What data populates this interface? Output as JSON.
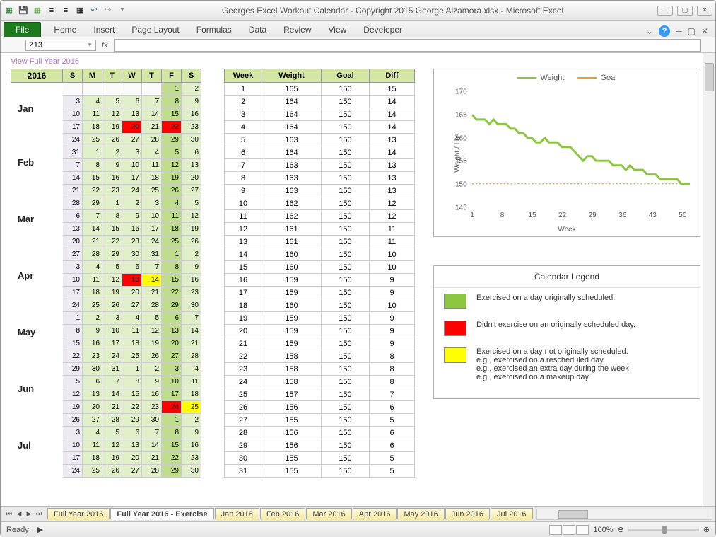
{
  "title": "Georges Excel Workout Calendar - Copyright 2015 George Alzamora.xlsx  -  Microsoft Excel",
  "ribbon": {
    "file": "File",
    "tabs": [
      "Home",
      "Insert",
      "Page Layout",
      "Formulas",
      "Data",
      "Review",
      "View",
      "Developer"
    ]
  },
  "namebox": "Z13",
  "fx": "fx",
  "link": "View Full Year 2016",
  "year": "2016",
  "day_heads": [
    "S",
    "M",
    "T",
    "W",
    "T",
    "F",
    "S"
  ],
  "months": [
    "Jan",
    "Feb",
    "Mar",
    "Apr",
    "May",
    "Jun",
    "Jul"
  ],
  "calendar_rows": [
    [
      [
        "",
        "b"
      ],
      [
        "",
        "b"
      ],
      [
        "",
        "b"
      ],
      [
        "",
        "b"
      ],
      [
        "",
        "b"
      ],
      [
        "1",
        "green"
      ],
      [
        "2",
        "lgreen"
      ]
    ],
    [
      [
        "3",
        "pale"
      ],
      [
        "4",
        "lgreen"
      ],
      [
        "5",
        "lgreen"
      ],
      [
        "6",
        "lgreen"
      ],
      [
        "7",
        "lgreen"
      ],
      [
        "8",
        "green"
      ],
      [
        "9",
        "lgreen"
      ]
    ],
    [
      [
        "10",
        "pale"
      ],
      [
        "11",
        "lgreen"
      ],
      [
        "12",
        "lgreen"
      ],
      [
        "13",
        "lgreen"
      ],
      [
        "14",
        "lgreen"
      ],
      [
        "15",
        "green"
      ],
      [
        "16",
        "lgreen"
      ]
    ],
    [
      [
        "17",
        "pale"
      ],
      [
        "18",
        "lgreen"
      ],
      [
        "19",
        "lgreen"
      ],
      [
        "20",
        "red"
      ],
      [
        "21",
        "lgreen"
      ],
      [
        "22",
        "red"
      ],
      [
        "23",
        "lgreen"
      ]
    ],
    [
      [
        "24",
        "pale"
      ],
      [
        "25",
        "lgreen"
      ],
      [
        "26",
        "lgreen"
      ],
      [
        "27",
        "lgreen"
      ],
      [
        "28",
        "lgreen"
      ],
      [
        "29",
        "green"
      ],
      [
        "30",
        "lgreen"
      ]
    ],
    [
      [
        "31",
        "pale"
      ],
      [
        "1",
        "lgreen"
      ],
      [
        "2",
        "lgreen"
      ],
      [
        "3",
        "lgreen"
      ],
      [
        "4",
        "lgreen"
      ],
      [
        "5",
        "green"
      ],
      [
        "6",
        "lgreen"
      ]
    ],
    [
      [
        "7",
        "pale"
      ],
      [
        "8",
        "lgreen"
      ],
      [
        "9",
        "lgreen"
      ],
      [
        "10",
        "lgreen"
      ],
      [
        "11",
        "lgreen"
      ],
      [
        "12",
        "green"
      ],
      [
        "13",
        "lgreen"
      ]
    ],
    [
      [
        "14",
        "pale"
      ],
      [
        "15",
        "lgreen"
      ],
      [
        "16",
        "lgreen"
      ],
      [
        "17",
        "lgreen"
      ],
      [
        "18",
        "lgreen"
      ],
      [
        "19",
        "green"
      ],
      [
        "20",
        "lgreen"
      ]
    ],
    [
      [
        "21",
        "pale"
      ],
      [
        "22",
        "lgreen"
      ],
      [
        "23",
        "lgreen"
      ],
      [
        "24",
        "lgreen"
      ],
      [
        "25",
        "lgreen"
      ],
      [
        "26",
        "green"
      ],
      [
        "27",
        "lgreen"
      ]
    ],
    [
      [
        "28",
        "pale"
      ],
      [
        "29",
        "lgreen"
      ],
      [
        "1",
        "lgreen"
      ],
      [
        "2",
        "lgreen"
      ],
      [
        "3",
        "lgreen"
      ],
      [
        "4",
        "green"
      ],
      [
        "5",
        "lgreen"
      ]
    ],
    [
      [
        "6",
        "pale"
      ],
      [
        "7",
        "lgreen"
      ],
      [
        "8",
        "lgreen"
      ],
      [
        "9",
        "lgreen"
      ],
      [
        "10",
        "lgreen"
      ],
      [
        "11",
        "green"
      ],
      [
        "12",
        "lgreen"
      ]
    ],
    [
      [
        "13",
        "pale"
      ],
      [
        "14",
        "lgreen"
      ],
      [
        "15",
        "lgreen"
      ],
      [
        "16",
        "lgreen"
      ],
      [
        "17",
        "lgreen"
      ],
      [
        "18",
        "green"
      ],
      [
        "19",
        "lgreen"
      ]
    ],
    [
      [
        "20",
        "pale"
      ],
      [
        "21",
        "lgreen"
      ],
      [
        "22",
        "lgreen"
      ],
      [
        "23",
        "lgreen"
      ],
      [
        "24",
        "lgreen"
      ],
      [
        "25",
        "green"
      ],
      [
        "26",
        "lgreen"
      ]
    ],
    [
      [
        "27",
        "pale"
      ],
      [
        "28",
        "lgreen"
      ],
      [
        "29",
        "lgreen"
      ],
      [
        "30",
        "lgreen"
      ],
      [
        "31",
        "lgreen"
      ],
      [
        "1",
        "green"
      ],
      [
        "2",
        "lgreen"
      ]
    ],
    [
      [
        "3",
        "pale"
      ],
      [
        "4",
        "lgreen"
      ],
      [
        "5",
        "lgreen"
      ],
      [
        "6",
        "lgreen"
      ],
      [
        "7",
        "lgreen"
      ],
      [
        "8",
        "green"
      ],
      [
        "9",
        "lgreen"
      ]
    ],
    [
      [
        "10",
        "pale"
      ],
      [
        "11",
        "lgreen"
      ],
      [
        "12",
        "lgreen"
      ],
      [
        "13",
        "red"
      ],
      [
        "14",
        "yellow"
      ],
      [
        "15",
        "green"
      ],
      [
        "16",
        "lgreen"
      ]
    ],
    [
      [
        "17",
        "pale"
      ],
      [
        "18",
        "lgreen"
      ],
      [
        "19",
        "lgreen"
      ],
      [
        "20",
        "lgreen"
      ],
      [
        "21",
        "lgreen"
      ],
      [
        "22",
        "green"
      ],
      [
        "23",
        "lgreen"
      ]
    ],
    [
      [
        "24",
        "pale"
      ],
      [
        "25",
        "lgreen"
      ],
      [
        "26",
        "lgreen"
      ],
      [
        "27",
        "lgreen"
      ],
      [
        "28",
        "lgreen"
      ],
      [
        "29",
        "green"
      ],
      [
        "30",
        "lgreen"
      ]
    ],
    [
      [
        "1",
        "pale"
      ],
      [
        "2",
        "lgreen"
      ],
      [
        "3",
        "lgreen"
      ],
      [
        "4",
        "lgreen"
      ],
      [
        "5",
        "lgreen"
      ],
      [
        "6",
        "green"
      ],
      [
        "7",
        "lgreen"
      ]
    ],
    [
      [
        "8",
        "pale"
      ],
      [
        "9",
        "lgreen"
      ],
      [
        "10",
        "lgreen"
      ],
      [
        "11",
        "lgreen"
      ],
      [
        "12",
        "lgreen"
      ],
      [
        "13",
        "green"
      ],
      [
        "14",
        "lgreen"
      ]
    ],
    [
      [
        "15",
        "pale"
      ],
      [
        "16",
        "lgreen"
      ],
      [
        "17",
        "lgreen"
      ],
      [
        "18",
        "lgreen"
      ],
      [
        "19",
        "lgreen"
      ],
      [
        "20",
        "green"
      ],
      [
        "21",
        "lgreen"
      ]
    ],
    [
      [
        "22",
        "pale"
      ],
      [
        "23",
        "lgreen"
      ],
      [
        "24",
        "lgreen"
      ],
      [
        "25",
        "lgreen"
      ],
      [
        "26",
        "lgreen"
      ],
      [
        "27",
        "green"
      ],
      [
        "28",
        "lgreen"
      ]
    ],
    [
      [
        "29",
        "pale"
      ],
      [
        "30",
        "lgreen"
      ],
      [
        "31",
        "lgreen"
      ],
      [
        "1",
        "lgreen"
      ],
      [
        "2",
        "lgreen"
      ],
      [
        "3",
        "green"
      ],
      [
        "4",
        "lgreen"
      ]
    ],
    [
      [
        "5",
        "pale"
      ],
      [
        "6",
        "lgreen"
      ],
      [
        "7",
        "lgreen"
      ],
      [
        "8",
        "lgreen"
      ],
      [
        "9",
        "lgreen"
      ],
      [
        "10",
        "green"
      ],
      [
        "11",
        "lgreen"
      ]
    ],
    [
      [
        "12",
        "pale"
      ],
      [
        "13",
        "lgreen"
      ],
      [
        "14",
        "lgreen"
      ],
      [
        "15",
        "lgreen"
      ],
      [
        "16",
        "lgreen"
      ],
      [
        "17",
        "green"
      ],
      [
        "18",
        "lgreen"
      ]
    ],
    [
      [
        "19",
        "pale"
      ],
      [
        "20",
        "lgreen"
      ],
      [
        "21",
        "lgreen"
      ],
      [
        "22",
        "lgreen"
      ],
      [
        "23",
        "lgreen"
      ],
      [
        "24",
        "red"
      ],
      [
        "25",
        "yellow"
      ]
    ],
    [
      [
        "26",
        "pale"
      ],
      [
        "27",
        "lgreen"
      ],
      [
        "28",
        "lgreen"
      ],
      [
        "29",
        "lgreen"
      ],
      [
        "30",
        "lgreen"
      ],
      [
        "1",
        "green"
      ],
      [
        "2",
        "lgreen"
      ]
    ],
    [
      [
        "3",
        "pale"
      ],
      [
        "4",
        "lgreen"
      ],
      [
        "5",
        "lgreen"
      ],
      [
        "6",
        "lgreen"
      ],
      [
        "7",
        "lgreen"
      ],
      [
        "8",
        "green"
      ],
      [
        "9",
        "lgreen"
      ]
    ],
    [
      [
        "10",
        "pale"
      ],
      [
        "11",
        "lgreen"
      ],
      [
        "12",
        "lgreen"
      ],
      [
        "13",
        "lgreen"
      ],
      [
        "14",
        "lgreen"
      ],
      [
        "15",
        "green"
      ],
      [
        "16",
        "lgreen"
      ]
    ],
    [
      [
        "17",
        "pale"
      ],
      [
        "18",
        "lgreen"
      ],
      [
        "19",
        "lgreen"
      ],
      [
        "20",
        "lgreen"
      ],
      [
        "21",
        "lgreen"
      ],
      [
        "22",
        "green"
      ],
      [
        "23",
        "lgreen"
      ]
    ],
    [
      [
        "24",
        "pale"
      ],
      [
        "25",
        "lgreen"
      ],
      [
        "26",
        "lgreen"
      ],
      [
        "27",
        "lgreen"
      ],
      [
        "28",
        "lgreen"
      ],
      [
        "29",
        "green"
      ],
      [
        "30",
        "lgreen"
      ]
    ]
  ],
  "wk_heads": [
    "Week",
    "Weight",
    "Goal",
    "Diff"
  ],
  "wk_rows": [
    [
      1,
      165,
      150,
      15
    ],
    [
      2,
      164,
      150,
      14
    ],
    [
      3,
      164,
      150,
      14
    ],
    [
      4,
      164,
      150,
      14
    ],
    [
      5,
      163,
      150,
      13
    ],
    [
      6,
      164,
      150,
      14
    ],
    [
      7,
      163,
      150,
      13
    ],
    [
      8,
      163,
      150,
      13
    ],
    [
      9,
      163,
      150,
      13
    ],
    [
      10,
      162,
      150,
      12
    ],
    [
      11,
      162,
      150,
      12
    ],
    [
      12,
      161,
      150,
      11
    ],
    [
      13,
      161,
      150,
      11
    ],
    [
      14,
      160,
      150,
      10
    ],
    [
      15,
      160,
      150,
      10
    ],
    [
      16,
      159,
      150,
      9
    ],
    [
      17,
      159,
      150,
      9
    ],
    [
      18,
      160,
      150,
      10
    ],
    [
      19,
      159,
      150,
      9
    ],
    [
      20,
      159,
      150,
      9
    ],
    [
      21,
      159,
      150,
      9
    ],
    [
      22,
      158,
      150,
      8
    ],
    [
      23,
      158,
      150,
      8
    ],
    [
      24,
      158,
      150,
      8
    ],
    [
      25,
      157,
      150,
      7
    ],
    [
      26,
      156,
      150,
      6
    ],
    [
      27,
      155,
      150,
      5
    ],
    [
      28,
      156,
      150,
      6
    ],
    [
      29,
      156,
      150,
      6
    ],
    [
      30,
      155,
      150,
      5
    ],
    [
      31,
      155,
      150,
      5
    ]
  ],
  "chart_data": {
    "type": "line",
    "title": "",
    "xlabel": "Week",
    "ylabel": "Weight / Lbs",
    "x_ticks": [
      1,
      8,
      15,
      22,
      29,
      36,
      43,
      50
    ],
    "y_ticks": [
      145,
      150,
      155,
      160,
      165,
      170
    ],
    "ylim": [
      145,
      170
    ],
    "xlim": [
      1,
      52
    ],
    "series": [
      {
        "name": "Weight",
        "color": "#8cc63f",
        "values": [
          165,
          164,
          164,
          164,
          163,
          164,
          163,
          163,
          163,
          162,
          162,
          161,
          161,
          160,
          160,
          159,
          159,
          160,
          159,
          159,
          159,
          158,
          158,
          158,
          157,
          156,
          155,
          156,
          156,
          155,
          155,
          155,
          155,
          154,
          154,
          154,
          153,
          154,
          153,
          153,
          153,
          152,
          152,
          152,
          151,
          151,
          151,
          151,
          151,
          150,
          150,
          150
        ]
      },
      {
        "name": "Goal",
        "color": "#f0a020",
        "values": [
          150,
          150,
          150,
          150,
          150,
          150,
          150,
          150,
          150,
          150,
          150,
          150,
          150,
          150,
          150,
          150,
          150,
          150,
          150,
          150,
          150,
          150,
          150,
          150,
          150,
          150,
          150,
          150,
          150,
          150,
          150,
          150,
          150,
          150,
          150,
          150,
          150,
          150,
          150,
          150,
          150,
          150,
          150,
          150,
          150,
          150,
          150,
          150,
          150,
          150,
          150,
          150
        ]
      }
    ],
    "legend": [
      "Weight",
      "Goal"
    ]
  },
  "legend_box": {
    "title": "Calendar Legend",
    "items": [
      {
        "color": "green",
        "text": "Exercised on a day originally scheduled."
      },
      {
        "color": "red",
        "text": "Didn't exercise on an originally scheduled day."
      },
      {
        "color": "yellow",
        "text": "Exercised on a day not originally scheduled.\ne.g., exercised on a rescheduled day\ne.g., exercised an extra day during the week\ne.g., exercised on a makeup day"
      }
    ]
  },
  "sheet_tabs": [
    "Full Year 2016",
    "Full Year 2016 - Exercise",
    "Jan 2016",
    "Feb 2016",
    "Mar 2016",
    "Apr 2016",
    "May 2016",
    "Jun 2016",
    "Jul 2016"
  ],
  "active_tab": 1,
  "status": "Ready",
  "zoom": "100%"
}
